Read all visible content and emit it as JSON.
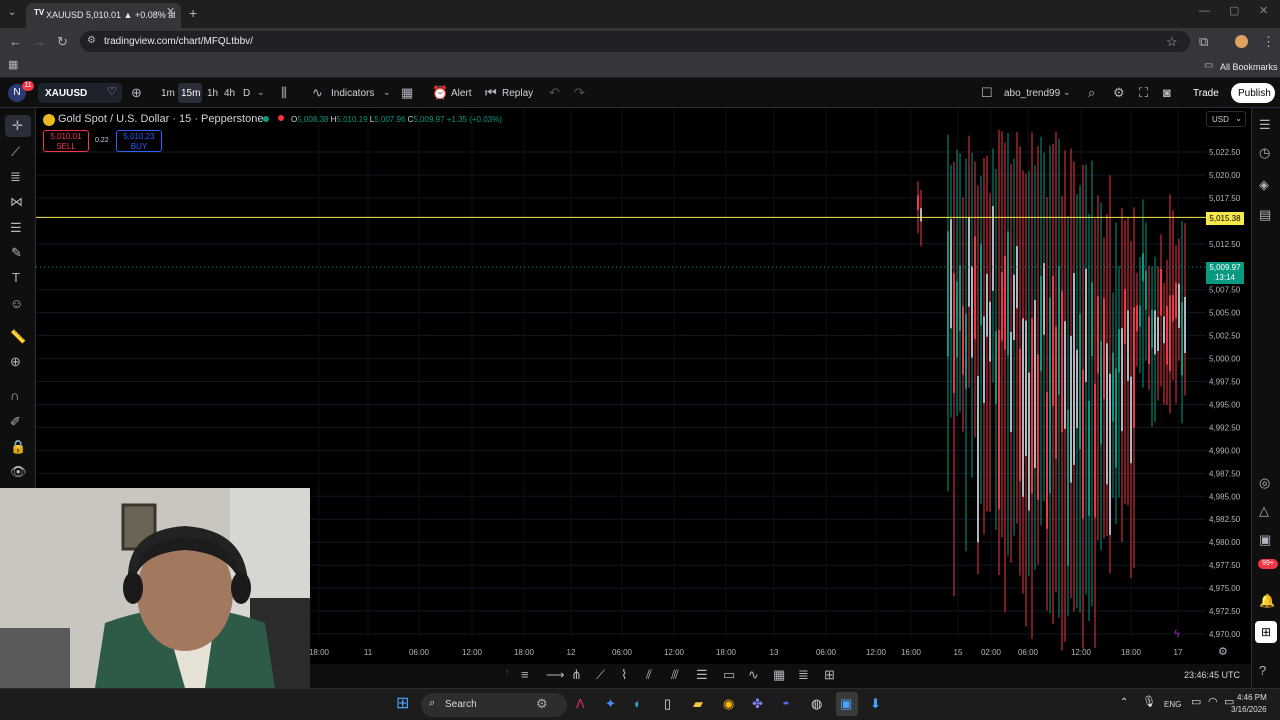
{
  "browser": {
    "tab_title": "XAUUSD 5,010.01 ▲ +0.08% al",
    "url": "tradingview.com/chart/MFQLtbbv/",
    "bookmarks_label": "All Bookmarks"
  },
  "toolbar": {
    "symbol": "XAUUSD",
    "intervals": [
      "1m",
      "15m",
      "1h",
      "4h",
      "D"
    ],
    "active_interval": "15m",
    "indicators_label": "Indicators",
    "alert_label": "Alert",
    "replay_label": "Replay",
    "layout_name": "abo_trend99",
    "trade_label": "Trade",
    "publish_label": "Publish",
    "badge_count": "11"
  },
  "legend": {
    "title": "Gold Spot / U.S. Dollar · 15 · Pepperstone",
    "open_label": "O",
    "open": "5,008.38",
    "high_label": "H",
    "high": "5,010.19",
    "low_label": "L",
    "low": "5,007.96",
    "close_label": "C",
    "close": "5,009.97",
    "change": "+1.35 (+0.03%)",
    "sell_price": "5,010.01",
    "sell_label": "SELL",
    "spread": "0.22",
    "buy_price": "5,010.23",
    "buy_label": "BUY"
  },
  "price_axis": {
    "currency": "USD",
    "labels": [
      "5,022.50",
      "5,020.00",
      "5,017.50",
      "5,012.50",
      "5,007.50",
      "5,005.00",
      "5,002.50",
      "5,000.00",
      "4,997.50",
      "4,995.00",
      "4,992.50",
      "4,990.00",
      "4,987.50",
      "4,985.00",
      "4,982.50",
      "4,980.00",
      "4,977.50",
      "4,975.00",
      "4,972.50",
      "4,970.00"
    ],
    "hline_price": "5,015.38",
    "current_price": "5,009.97",
    "countdown": "13:14"
  },
  "time_axis": {
    "labels": [
      "18:00",
      "11",
      "06:00",
      "12:00",
      "18:00",
      "12",
      "06:00",
      "12:00",
      "18:00",
      "13",
      "06:00",
      "12:00",
      "16:00",
      "15",
      "02:00",
      "06:00",
      "12:00",
      "18:00",
      "17"
    ],
    "clock": "23:46:45 UTC"
  },
  "colors": {
    "up": "#089981",
    "down": "#f23645",
    "hline": "#f7e94a",
    "accent": "#2962ff"
  },
  "taskbar": {
    "search_label": "Search",
    "lang": "ENG",
    "time": "4:46 PM",
    "date": "3/16/2026"
  },
  "rightbar": {
    "notif_count": "99+"
  }
}
